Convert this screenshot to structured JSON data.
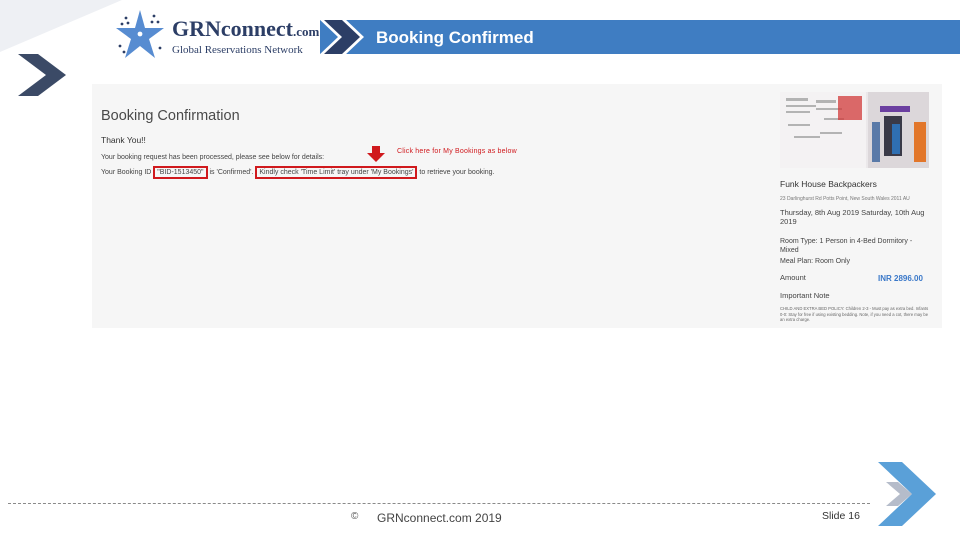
{
  "header": {
    "logo_name": "GRNconnect",
    "logo_suffix": ".com",
    "logo_tagline": "Global Reservations Network",
    "title": "Booking Confirmed"
  },
  "booking": {
    "heading": "Booking Confirmation",
    "thank_you": "Thank You!!",
    "processed": "Your booking request has been processed, please see below for details:",
    "line_prefix": "Your Booking ID",
    "booking_id": "\"BID-1513450\"",
    "line_mid": "is 'Confirmed'.",
    "check_text": "Kindly check 'Time Limit' tray under 'My Bookings'",
    "line_suffix": "to retrieve your booking.",
    "click_note": "Click here for My Bookings as below"
  },
  "hostel": {
    "name": "Funk House Backpackers",
    "address": "23 Darlinghurst Rd Potts Point, New South Wales 2011 AU",
    "dates": "Thursday, 8th Aug 2019 Saturday, 10th Aug 2019",
    "room_type": "Room Type: 1 Person in 4-Bed Dormitory - Mixed",
    "meal_plan": "Meal Plan: Room Only",
    "amount_label": "Amount",
    "amount_value": "INR 2896.00",
    "important_note": "Important Note",
    "policy": "CHILD AND EXTRA BED POLICY: Children 2-3 - Must pay as extra bed. Infants 0-0: Stay for free if using existing bedding. Note, if you need a cot, there may be an extra charge."
  },
  "footer": {
    "copyright_symbol": "©",
    "text": "GRNconnect.com 2019",
    "slide": "Slide 16"
  },
  "colors": {
    "title_bar": "#3f7dc2",
    "highlight_red": "#d0191d",
    "brand_navy": "#2c3e66",
    "chevron_light": "#5aa0d8"
  }
}
